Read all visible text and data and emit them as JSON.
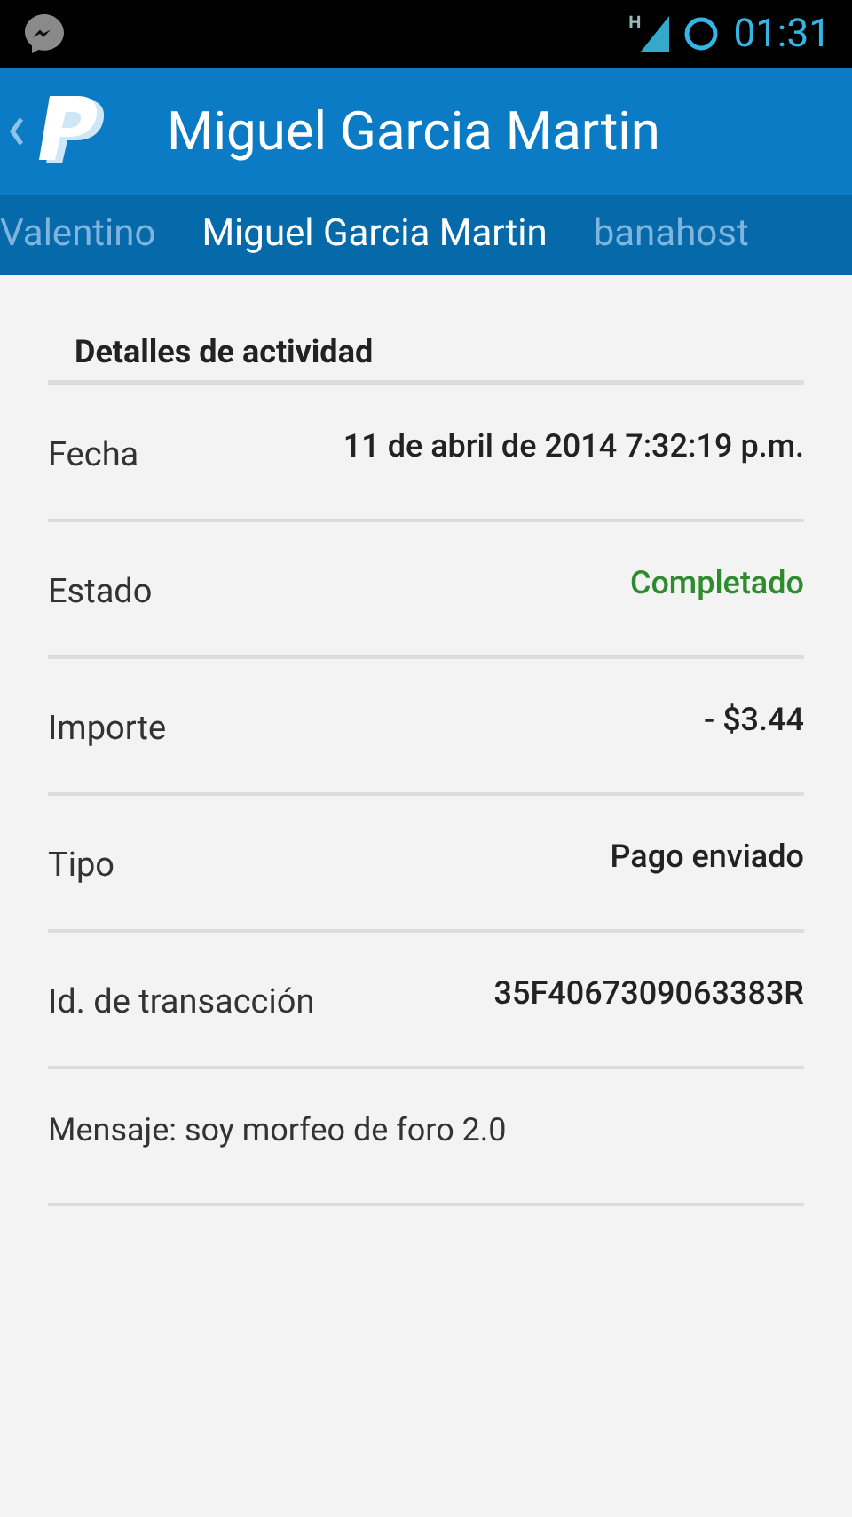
{
  "status_bar": {
    "time": "01:31",
    "network": "H"
  },
  "header": {
    "title": "Miguel Garcia Martin"
  },
  "tabs": [
    {
      "label": "Valentino",
      "selected": false
    },
    {
      "label": "Miguel Garcia Martin",
      "selected": true
    },
    {
      "label": "banahost",
      "selected": false
    }
  ],
  "section": {
    "title": "Detalles de actividad"
  },
  "rows": [
    {
      "kind": "pair",
      "label": "Fecha",
      "value": "11 de abril de 2014 7:32:19 p.m."
    },
    {
      "kind": "pair",
      "label": "Estado",
      "value": "Completado",
      "color": "#2e8b2e"
    },
    {
      "kind": "pair",
      "label": "Importe",
      "value": "- $3.44"
    },
    {
      "kind": "pair",
      "label": "Tipo",
      "value": "Pago enviado"
    },
    {
      "kind": "pair",
      "label": "Id. de transacción",
      "value": "35F4067309063383R"
    },
    {
      "kind": "message",
      "label": "Mensaje: soy morfeo de foro 2.0"
    }
  ]
}
